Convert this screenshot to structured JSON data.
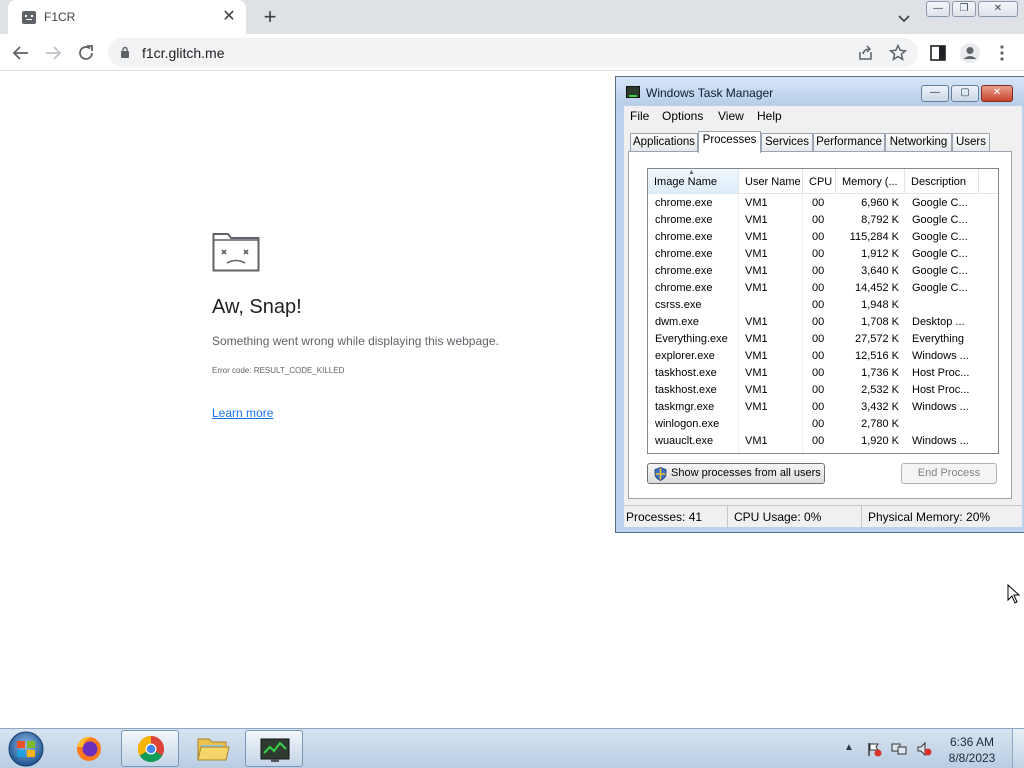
{
  "browser": {
    "tab_title": "F1CR",
    "url": "f1cr.glitch.me"
  },
  "error_page": {
    "title": "Aw, Snap!",
    "message": "Something went wrong while displaying this webpage.",
    "error_code": "Error code: RESULT_CODE_KILLED",
    "learn_more": "Learn more"
  },
  "task_manager": {
    "title": "Windows Task Manager",
    "menu": [
      "File",
      "Options",
      "View",
      "Help"
    ],
    "tabs": [
      "Applications",
      "Processes",
      "Services",
      "Performance",
      "Networking",
      "Users"
    ],
    "active_tab": "Processes",
    "columns": [
      "Image Name",
      "User Name",
      "CPU",
      "Memory (...",
      "Description"
    ],
    "processes": [
      {
        "image": "chrome.exe",
        "user": "VM1",
        "cpu": "00",
        "memory": "6,960 K",
        "desc": "Google C..."
      },
      {
        "image": "chrome.exe",
        "user": "VM1",
        "cpu": "00",
        "memory": "8,792 K",
        "desc": "Google C..."
      },
      {
        "image": "chrome.exe",
        "user": "VM1",
        "cpu": "00",
        "memory": "115,284 K",
        "desc": "Google C..."
      },
      {
        "image": "chrome.exe",
        "user": "VM1",
        "cpu": "00",
        "memory": "1,912 K",
        "desc": "Google C..."
      },
      {
        "image": "chrome.exe",
        "user": "VM1",
        "cpu": "00",
        "memory": "3,640 K",
        "desc": "Google C..."
      },
      {
        "image": "chrome.exe",
        "user": "VM1",
        "cpu": "00",
        "memory": "14,452 K",
        "desc": "Google C..."
      },
      {
        "image": "csrss.exe",
        "user": "",
        "cpu": "00",
        "memory": "1,948 K",
        "desc": ""
      },
      {
        "image": "dwm.exe",
        "user": "VM1",
        "cpu": "00",
        "memory": "1,708 K",
        "desc": "Desktop ..."
      },
      {
        "image": "Everything.exe",
        "user": "VM1",
        "cpu": "00",
        "memory": "27,572 K",
        "desc": "Everything"
      },
      {
        "image": "explorer.exe",
        "user": "VM1",
        "cpu": "00",
        "memory": "12,516 K",
        "desc": "Windows ..."
      },
      {
        "image": "taskhost.exe",
        "user": "VM1",
        "cpu": "00",
        "memory": "1,736 K",
        "desc": "Host Proc..."
      },
      {
        "image": "taskhost.exe",
        "user": "VM1",
        "cpu": "00",
        "memory": "2,532 K",
        "desc": "Host Proc..."
      },
      {
        "image": "taskmgr.exe",
        "user": "VM1",
        "cpu": "00",
        "memory": "3,432 K",
        "desc": "Windows ..."
      },
      {
        "image": "winlogon.exe",
        "user": "",
        "cpu": "00",
        "memory": "2,780 K",
        "desc": ""
      },
      {
        "image": "wuauclt.exe",
        "user": "VM1",
        "cpu": "00",
        "memory": "1,920 K",
        "desc": "Windows ..."
      }
    ],
    "show_all_button": "Show processes from all users",
    "end_process_button": "End Process",
    "status": {
      "processes": "Processes: 41",
      "cpu": "CPU Usage: 0%",
      "memory": "Physical Memory: 20%"
    }
  },
  "taskbar": {
    "time": "6:36 AM",
    "date": "8/8/2023"
  }
}
